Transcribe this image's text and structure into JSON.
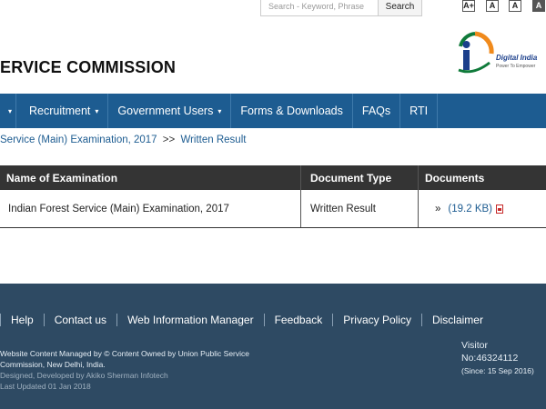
{
  "topbar": {
    "search_placeholder": "Search - Keyword, Phrase",
    "search_button": "Search",
    "font_sizes": [
      "A+",
      "A",
      "A",
      "A"
    ]
  },
  "header": {
    "title": "ERVICE COMMISSION",
    "logo_text": "Digital India",
    "logo_sub": "Power To Empower"
  },
  "nav": {
    "items": [
      {
        "label": "Recruitment",
        "caret": "▾"
      },
      {
        "label": "Government Users",
        "caret": "▾"
      },
      {
        "label": "Forms & Downloads"
      },
      {
        "label": "FAQs"
      },
      {
        "label": "RTI"
      }
    ]
  },
  "breadcrumb": {
    "item1": "Service (Main) Examination, 2017",
    "separator": ">>",
    "item2": "Written Result"
  },
  "table": {
    "headers": [
      "Name of Examination",
      "Document Type",
      "Documents"
    ],
    "rows": [
      {
        "name": "Indian Forest Service (Main) Examination, 2017",
        "type": "Written Result",
        "bullet": "»",
        "doc": "(19.2 KB)"
      }
    ]
  },
  "footer": {
    "links": [
      "Help",
      "Contact us",
      "Web Information Manager",
      "Feedback",
      "Privacy Policy",
      "Disclaimer"
    ],
    "managed": "Website Content Managed by © Content Owned by Union Public Service Commission, New Delhi, India.",
    "designed": "Designed, Developed by Akiko Sherman Infotech",
    "updated": "Last Updated 01 Jan 2018",
    "visitor_label": "Visitor",
    "visitor_no": "No:46324112",
    "visitor_since": "(Since: 15 Sep 2016)"
  },
  "colors": {
    "nav_bg": "#1d5c91",
    "table_header_bg": "#343434",
    "footer_bg": "#2e4a63",
    "link": "#1d5c91"
  }
}
